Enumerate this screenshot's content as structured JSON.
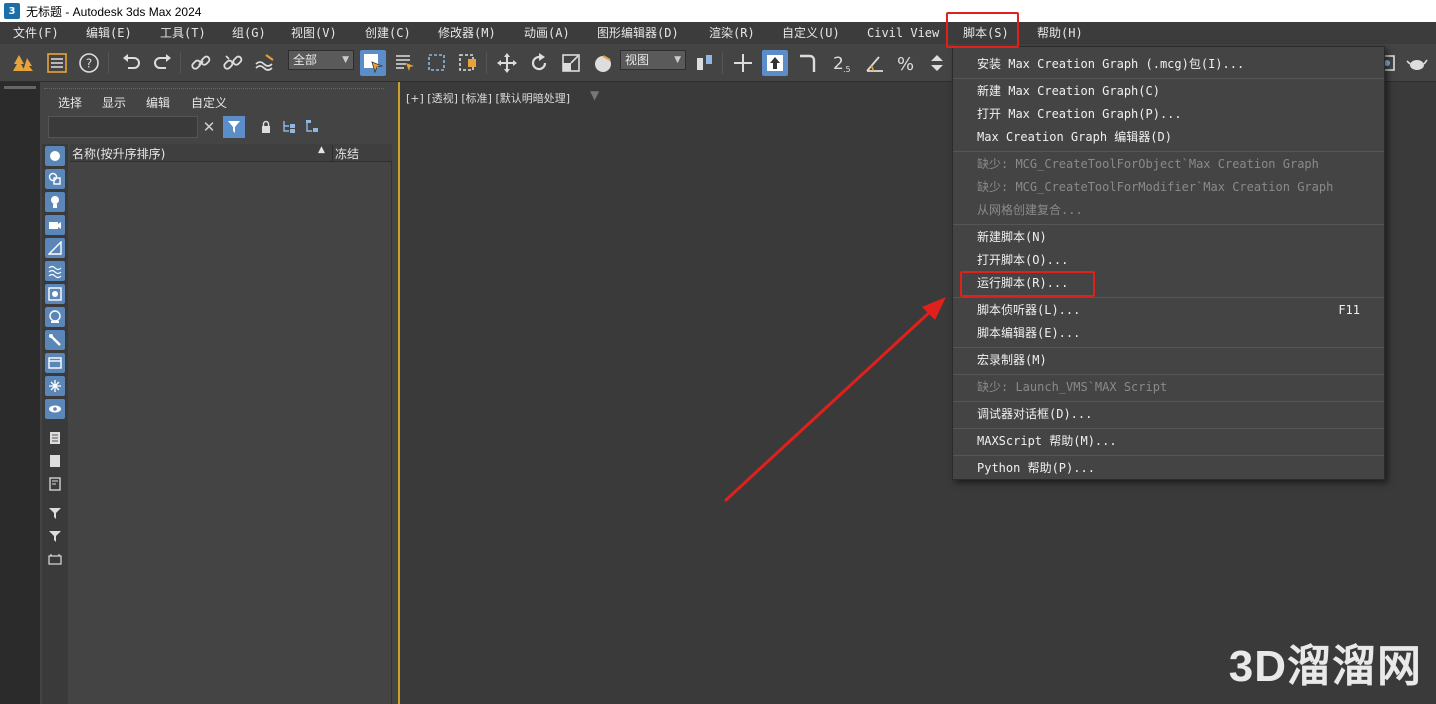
{
  "window": {
    "app_icon": "3",
    "title": "无标题 - Autodesk 3ds Max 2024"
  },
  "menubar": {
    "items": [
      "文件(F)",
      "编辑(E)",
      "工具(T)",
      "组(G)",
      "视图(V)",
      "创建(C)",
      "修改器(M)",
      "动画(A)",
      "图形编辑器(D)",
      "渲染(R)",
      "自定义(U)",
      "Civil View",
      "脚本(S)",
      "帮助(H)"
    ]
  },
  "toolbar": {
    "selection_filter": "全部",
    "coord_system": "视图",
    "snap_value": "2.5",
    "icons": [
      "undo-icon",
      "redo-icon",
      "link-icon",
      "unlink-icon",
      "bind-spacewarp-icon",
      "select-object-icon",
      "select-by-name-icon",
      "rect-selection-icon",
      "window-crossing-icon",
      "move-icon",
      "rotate-icon",
      "scale-icon",
      "place-icon",
      "pivot-icon",
      "snap-icon",
      "angle-snap-icon",
      "percent-snap-icon",
      "spinner-snap-icon"
    ]
  },
  "explorer": {
    "menu": [
      "选择",
      "显示",
      "编辑",
      "自定义"
    ],
    "search_value": "",
    "column_name": "名称(按升序排序)",
    "sort_arrow": "▲",
    "column_frozen": "冻结",
    "clear_glyph": "✕"
  },
  "viewport": {
    "label": "[+] [透视] [标准] [默认明暗处理]",
    "filter_glyph": "▼"
  },
  "script_menu": {
    "items": [
      {
        "label": "安装 Max Creation Graph (.mcg)包(I)...",
        "disabled": false
      },
      {
        "label": "新建 Max Creation Graph(C)",
        "disabled": false
      },
      {
        "label": "打开 Max Creation Graph(P)...",
        "disabled": false
      },
      {
        "label": "Max Creation Graph  编辑器(D)",
        "disabled": false
      },
      {
        "label": "缺少: MCG_CreateToolForObject`Max Creation Graph",
        "disabled": true
      },
      {
        "label": "缺少: MCG_CreateToolForModifier`Max Creation Graph",
        "disabled": true
      },
      {
        "label": "从网格创建复合...",
        "disabled": true
      },
      {
        "label": "新建脚本(N)",
        "disabled": false
      },
      {
        "label": "打开脚本(O)...",
        "disabled": false
      },
      {
        "label": "运行脚本(R)...",
        "disabled": false
      },
      {
        "label": "脚本侦听器(L)...",
        "disabled": false,
        "shortcut": "F11"
      },
      {
        "label": "脚本编辑器(E)...",
        "disabled": false
      },
      {
        "label": "宏录制器(M)",
        "disabled": false
      },
      {
        "label": "缺少: Launch_VMS`MAX Script",
        "disabled": true
      },
      {
        "label": "调试器对话框(D)...",
        "disabled": false
      },
      {
        "label": "MAXScript 帮助(M)...",
        "disabled": false
      },
      {
        "label": "Python 帮助(P)...",
        "disabled": false
      }
    ]
  },
  "watermark": "3D溜溜网",
  "colors": {
    "highlight": "#e0201a",
    "accent": "#5b8ec9",
    "viewport_border": "#c9a227"
  }
}
